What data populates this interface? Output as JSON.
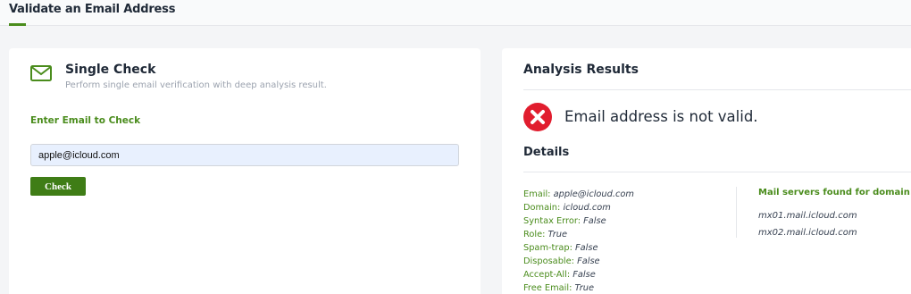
{
  "header": {
    "title": "Validate an Email Address"
  },
  "colors": {
    "accent": "#4a8c1c",
    "button": "#3f7d16",
    "error": "#e11d2e"
  },
  "single_check": {
    "icon": "mail-icon",
    "title": "Single Check",
    "subtitle": "Perform single email verification with deep analysis result.",
    "input_label": "Enter Email to Check",
    "email_value": "apple@icloud.com",
    "check_label": "Check"
  },
  "analysis": {
    "title": "Analysis Results",
    "status_icon": "error-x-icon",
    "status_text": "Email address is not valid.",
    "details_title": "Details",
    "details": [
      {
        "label": "Email:",
        "value": "apple@icloud.com"
      },
      {
        "label": "Domain:",
        "value": "icloud.com"
      },
      {
        "label": "Syntax Error:",
        "value": "False"
      },
      {
        "label": "Role:",
        "value": "True"
      },
      {
        "label": "Spam-trap:",
        "value": "False"
      },
      {
        "label": "Disposable:",
        "value": "False"
      },
      {
        "label": "Accept-All:",
        "value": "False"
      },
      {
        "label": "Free Email:",
        "value": "True"
      }
    ],
    "mx_title": "Mail servers found for domain:",
    "mx_servers": [
      "mx01.mail.icloud.com",
      "mx02.mail.icloud.com"
    ]
  }
}
